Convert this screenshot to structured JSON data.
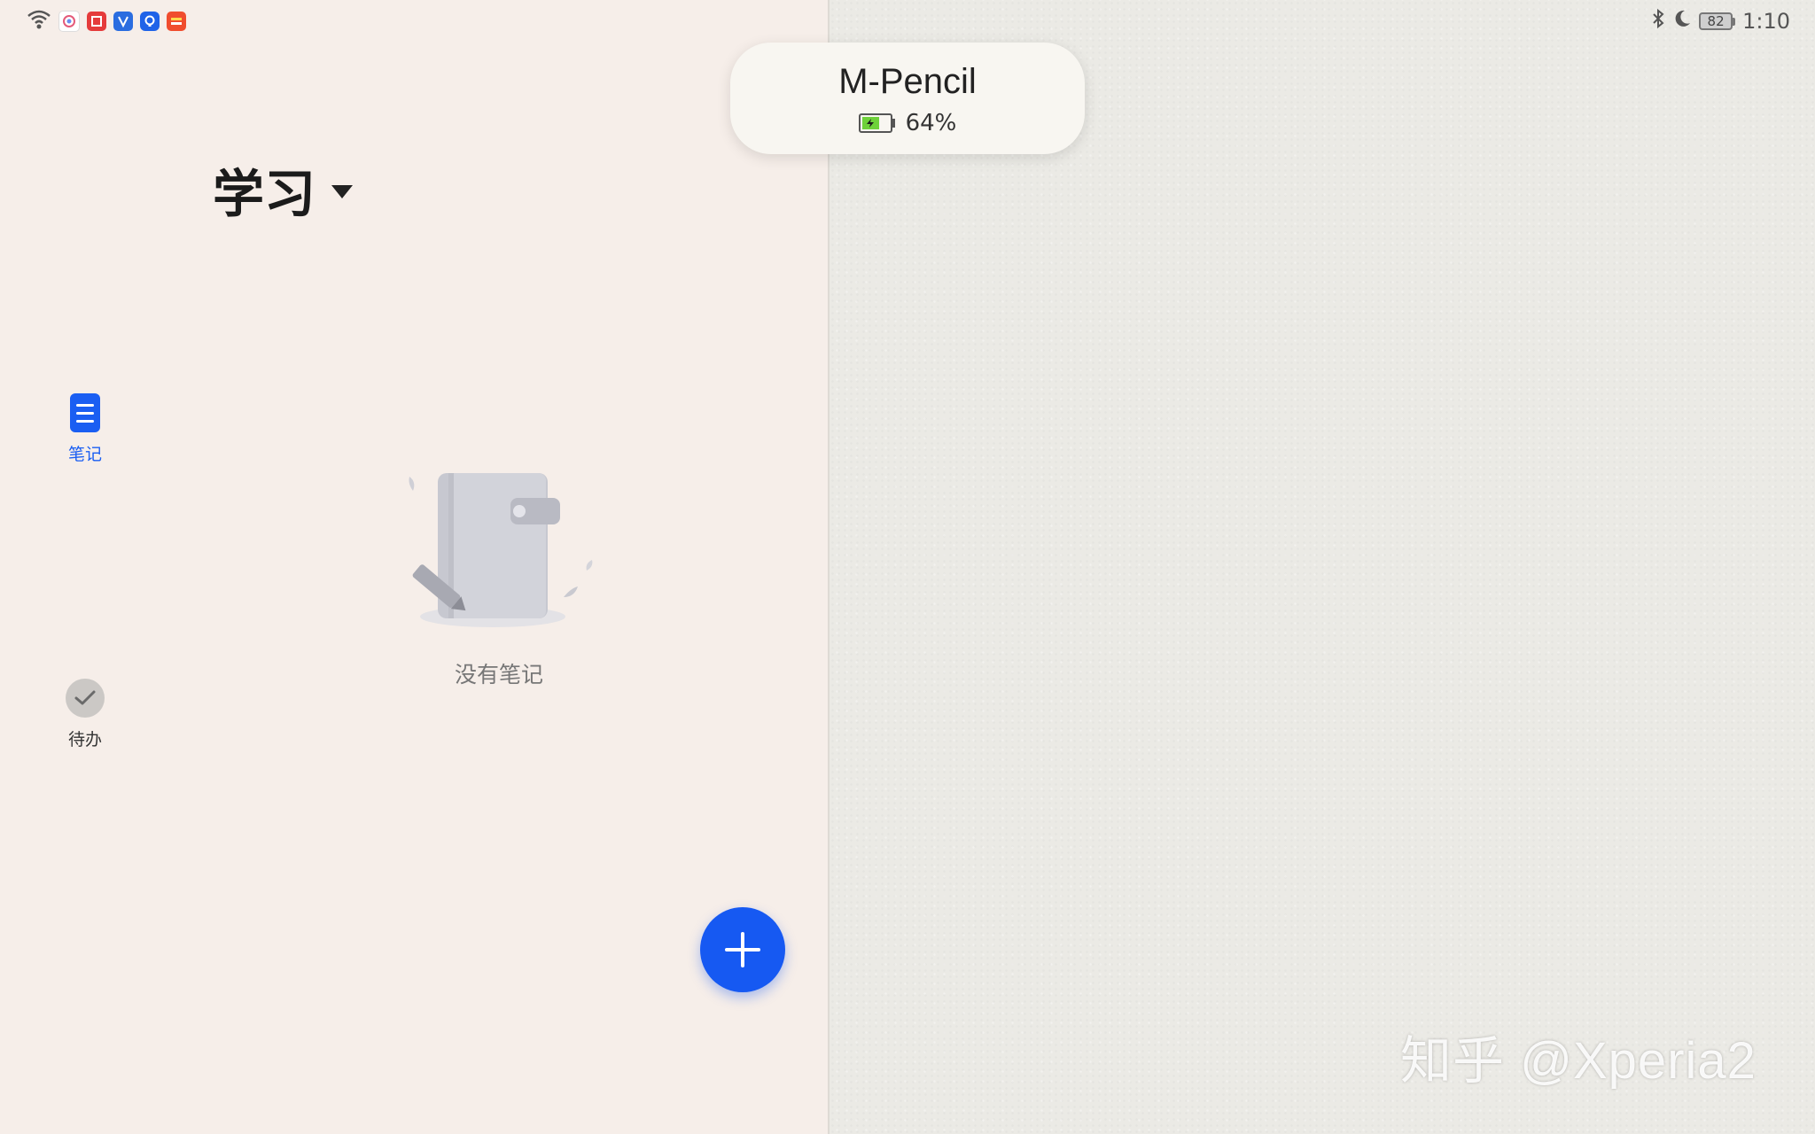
{
  "status_bar": {
    "time": "1:10",
    "battery_level": "82",
    "left_icons": [
      "wifi-icon",
      "app-icon-browser",
      "app-icon-red-book",
      "app-icon-blue-scan",
      "app-icon-tips",
      "app-icon-gallery"
    ],
    "right_icons": [
      "bluetooth-icon",
      "moon-icon",
      "battery-icon"
    ]
  },
  "pencil_popup": {
    "device_name": "M-Pencil",
    "battery_percent": "64%",
    "battery_fill": 0.64
  },
  "folder": {
    "title": "学习"
  },
  "nav": {
    "items": [
      {
        "label": "笔记",
        "icon": "notes-icon",
        "active": true,
        "color": "#1a5ef2"
      },
      {
        "label": "待办",
        "icon": "check-icon",
        "active": false,
        "color": "#333333"
      }
    ]
  },
  "empty_state": {
    "text": "没有笔记"
  },
  "fab": {
    "icon": "plus-icon",
    "color": "#1659f2"
  },
  "watermark": {
    "text": "知乎 @Xperia2"
  }
}
